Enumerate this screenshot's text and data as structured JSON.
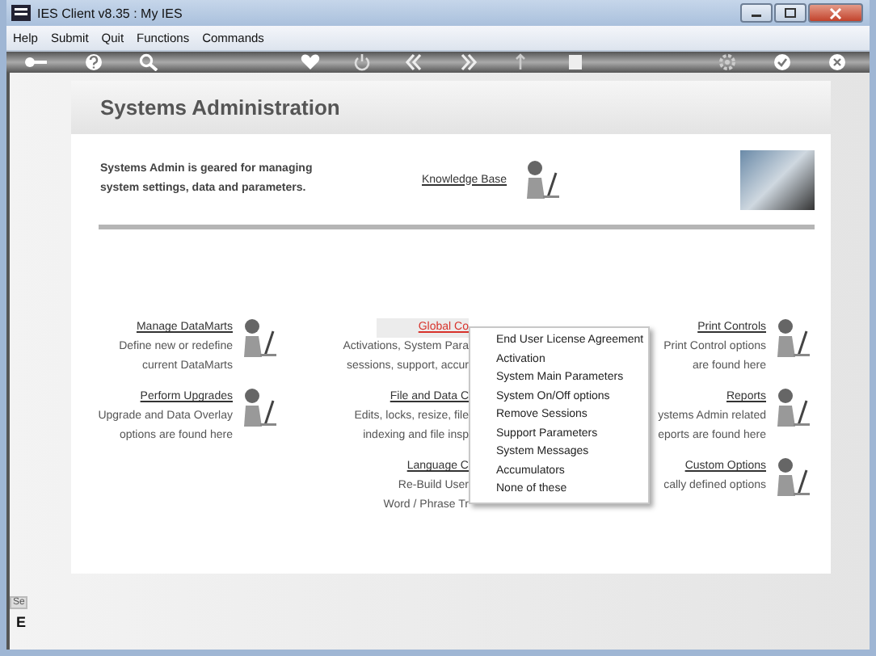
{
  "window": {
    "title": "IES Client v8.35 : My IES"
  },
  "menu": [
    "Help",
    "Submit",
    "Quit",
    "Functions",
    "Commands"
  ],
  "page": {
    "title": "Systems Administration",
    "intro": [
      "Systems Admin is geared for managing",
      "system settings, data and parameters."
    ],
    "link": "Knowledge Base"
  },
  "columns": [
    {
      "items": [
        {
          "title": "Manage DataMarts",
          "highlighted": false,
          "icon": true,
          "lines": [
            "Define new or redefine",
            "current DataMarts"
          ]
        },
        {
          "title": "Perform Upgrades",
          "highlighted": false,
          "icon": true,
          "lines": [
            "Upgrade and Data Overlay",
            "options are found here"
          ]
        }
      ]
    },
    {
      "items": [
        {
          "title": "Global Co",
          "highlighted": true,
          "icon": false,
          "lines": [
            "Activations, System Para",
            "sessions, support, accur"
          ]
        },
        {
          "title": "File and Data C",
          "highlighted": false,
          "icon": false,
          "lines": [
            "Edits, locks, resize, file",
            "indexing and file insp"
          ]
        },
        {
          "title": "Language C",
          "highlighted": false,
          "icon": false,
          "lines": [
            "Re-Build User",
            "Word / Phrase Tr"
          ]
        }
      ]
    },
    {
      "items": [
        {
          "title": "Print Controls",
          "highlighted": false,
          "icon": true,
          "lines": [
            "Print Control options",
            "are found here"
          ]
        },
        {
          "title": "Reports",
          "highlighted": false,
          "icon": true,
          "lines": [
            "ystems Admin related",
            "eports are found here"
          ]
        },
        {
          "title": "Custom Options",
          "highlighted": false,
          "icon": true,
          "lines": [
            "cally defined options"
          ]
        }
      ]
    }
  ],
  "popup_menu": {
    "items": [
      "End User License Agreement",
      "Activation",
      "System Main Parameters",
      "System On/Off options",
      "Remove Sessions",
      "Support Parameters",
      "System Messages",
      "Accumulators",
      "None of these"
    ]
  },
  "side_strip": {
    "tab": "Se",
    "label": "E"
  }
}
